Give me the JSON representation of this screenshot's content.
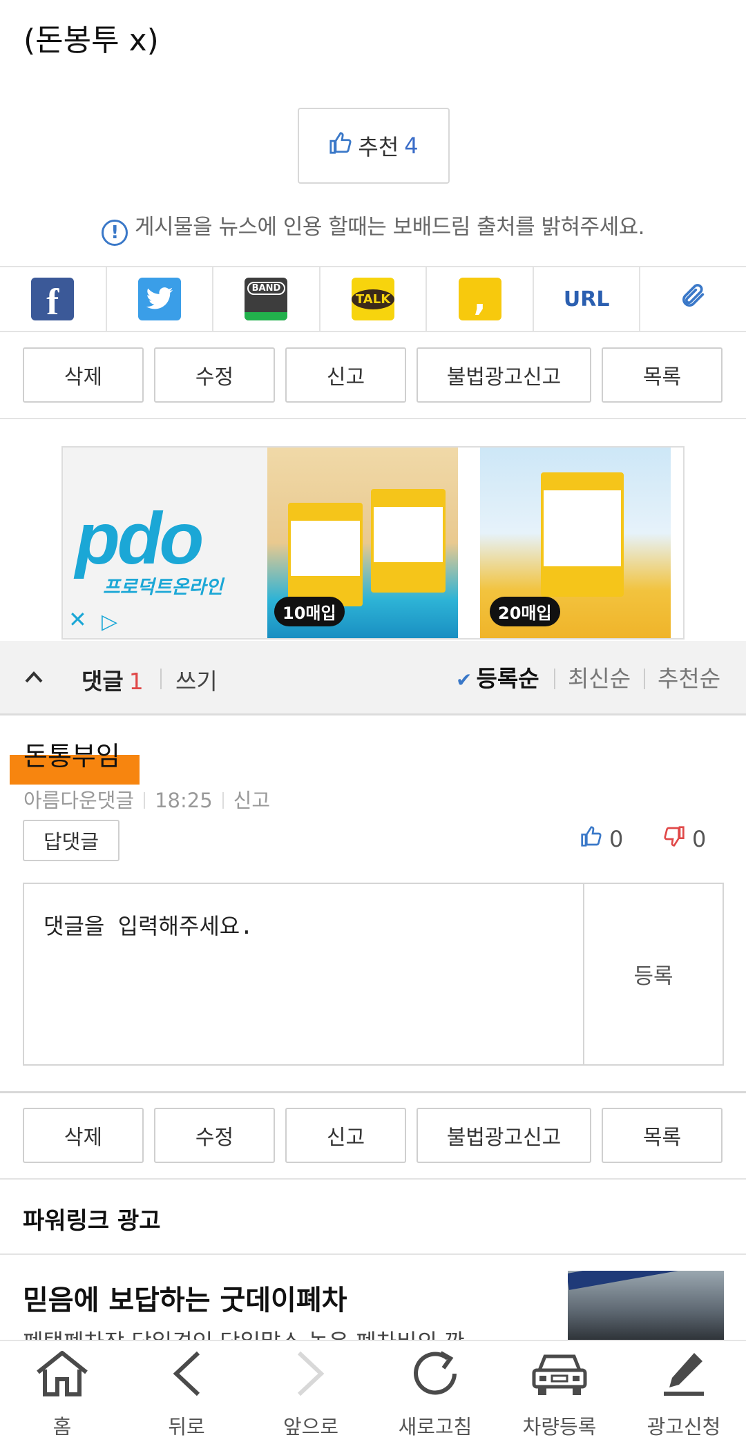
{
  "post": {
    "tail_text": "(돈봉투 x)"
  },
  "recommend": {
    "label": "추천",
    "count": "4"
  },
  "notice": {
    "text": "게시물을 뉴스에 인용 할때는 보배드림 출처를 밝혀주세요."
  },
  "share": {
    "band_label": "BAND",
    "talk_label": "TALK",
    "url_label": "URL"
  },
  "actions": [
    "삭제",
    "수정",
    "신고",
    "불법광고신고",
    "목록"
  ],
  "ad": {
    "logo": "pdo",
    "logo_sub": "프로덕트온라인",
    "badge1": "10매입",
    "badge2": "20매입"
  },
  "comments": {
    "label": "댓글",
    "count": "1",
    "write": "쓰기",
    "sort": [
      "등록순",
      "최신순",
      "추천순"
    ],
    "active_sort": "등록순"
  },
  "comment": {
    "author": "돈통부임",
    "badge": "아름다운댓글",
    "time": "18:25",
    "report": "신고",
    "reply": "답댓글",
    "up": "0",
    "down": "0"
  },
  "comment_input": {
    "placeholder": "댓글을 입력해주세요.",
    "submit": "등록"
  },
  "powerlink": {
    "title": "파워링크 광고",
    "item_title": "믿음에 보답하는 굿데이폐차",
    "item_desc": "폐택폐차장 당일견인 당일말소 높은 폐차비의 깐"
  },
  "nav": [
    {
      "label": "홈",
      "icon": "home-icon"
    },
    {
      "label": "뒤로",
      "icon": "back-icon"
    },
    {
      "label": "앞으로",
      "icon": "forward-icon"
    },
    {
      "label": "새로고침",
      "icon": "refresh-icon"
    },
    {
      "label": "차량등록",
      "icon": "car-icon"
    },
    {
      "label": "광고신청",
      "icon": "pen-icon"
    }
  ]
}
